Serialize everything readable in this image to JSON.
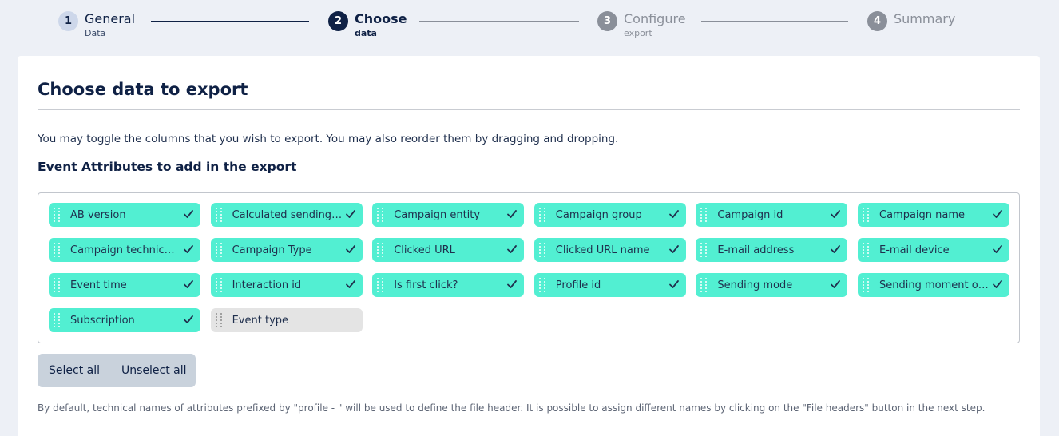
{
  "stepper": {
    "steps": [
      {
        "number": "1",
        "title": "General",
        "subtitle": "Data",
        "state": "done"
      },
      {
        "number": "2",
        "title": "Choose",
        "subtitle": "data",
        "state": "active"
      },
      {
        "number": "3",
        "title": "Configure",
        "subtitle": "export",
        "state": "todo"
      },
      {
        "number": "4",
        "title": "Summary",
        "subtitle": "",
        "state": "todo"
      }
    ]
  },
  "page": {
    "title": "Choose data to export",
    "description": "You may toggle the columns that you wish to export. You may also reorder them by dragging and dropping.",
    "section_title": "Event Attributes to add in the export"
  },
  "attributes": [
    {
      "label": "AB version",
      "selected": true
    },
    {
      "label": "Calculated sending …",
      "selected": true
    },
    {
      "label": "Campaign entity",
      "selected": true
    },
    {
      "label": "Campaign group",
      "selected": true
    },
    {
      "label": "Campaign id",
      "selected": true
    },
    {
      "label": "Campaign name",
      "selected": true
    },
    {
      "label": "Campaign technical…",
      "selected": true
    },
    {
      "label": "Campaign Type",
      "selected": true
    },
    {
      "label": "Clicked URL",
      "selected": true
    },
    {
      "label": "Clicked URL name",
      "selected": true
    },
    {
      "label": "E-mail address",
      "selected": true
    },
    {
      "label": "E-mail device",
      "selected": true
    },
    {
      "label": "Event time",
      "selected": true
    },
    {
      "label": "Interaction id",
      "selected": true
    },
    {
      "label": "Is first click?",
      "selected": true
    },
    {
      "label": "Profile id",
      "selected": true
    },
    {
      "label": "Sending mode",
      "selected": true
    },
    {
      "label": "Sending moment op…",
      "selected": true
    },
    {
      "label": "Subscription",
      "selected": true
    },
    {
      "label": "Event type",
      "selected": false
    }
  ],
  "actions": {
    "select_all": "Select all",
    "unselect_all": "Unselect all"
  },
  "footnote": "By default, technical names of attributes prefixed by \"profile - \" will be used to define the file header. It is possible to assign different names by clicking on the \"File headers\" button in the next step.",
  "colors": {
    "chip_selected": "#52efd2",
    "chip_unselected": "#e4e4e4",
    "navy": "#0f2145"
  },
  "icons": {
    "chip_check": "check-icon",
    "chip_handle": "drag-handle-icon"
  }
}
